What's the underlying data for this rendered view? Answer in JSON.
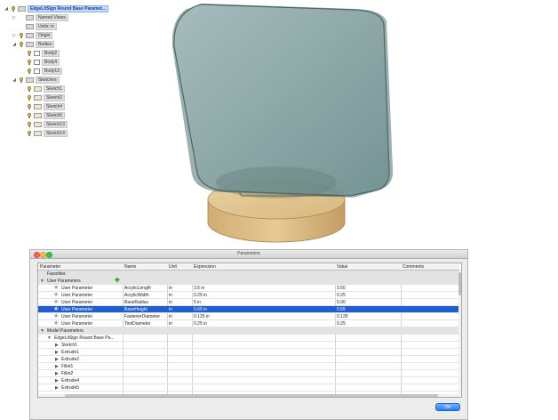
{
  "browser": {
    "nodes": [
      {
        "label": "EdgeLitSign Round Base Paramet...",
        "selected": true
      },
      {
        "label": "Named Views"
      },
      {
        "label": "Units: in"
      },
      {
        "label": "Origin"
      },
      {
        "label": "Bodies"
      },
      {
        "label": "Body2"
      },
      {
        "label": "Body4"
      },
      {
        "label": "Body13"
      },
      {
        "label": "Sketches"
      },
      {
        "label": "Sketch1"
      },
      {
        "label": "Sketch2"
      },
      {
        "label": "Sketch4"
      },
      {
        "label": "Sketch5"
      },
      {
        "label": "Sketch13"
      },
      {
        "label": "Sketch14"
      }
    ],
    "arrows": {
      "expanded": "◢",
      "collapsed": "▷"
    }
  },
  "viewport": {
    "colors": {
      "acrylic": "#7a9a9a",
      "acrylic_edge": "#4d6b6b",
      "wood_top": "#e2c48f",
      "wood_side": "#c9a56b",
      "wood_dark": "#a88450"
    }
  },
  "dialog": {
    "title": "Parameters",
    "ok_label": "OK",
    "window_buttons": {
      "close": "#fc605b",
      "minimize": "#fdbc40",
      "zoom": "#34c84a"
    },
    "columns": {
      "parameter": "Parameter",
      "name": "Name",
      "unit": "Unit",
      "expression": "Expression",
      "value": "Value",
      "comments": "Comments"
    },
    "favorites_label": "Favorites",
    "user_group_label": "User Parameters",
    "add_icon": "✚",
    "user_parameters": [
      {
        "parameter": "User Parameter",
        "name": "AcrylicLength",
        "unit": "in",
        "expression": "3.5 in",
        "value": "3.50",
        "comments": ""
      },
      {
        "parameter": "User Parameter",
        "name": "AcrylicWidth",
        "unit": "in",
        "expression": "0.25 in",
        "value": "0.25",
        "comments": ""
      },
      {
        "parameter": "User Parameter",
        "name": "BaseRadius",
        "unit": "in",
        "expression": "5 in",
        "value": "5.00",
        "comments": ""
      },
      {
        "parameter": "User Parameter",
        "name": "BaseHeight",
        "unit": "in",
        "expression": "0.65 in",
        "value": "0.65",
        "comments": "",
        "selected": true
      },
      {
        "parameter": "User Parameter",
        "name": "FastenerDiameter",
        "unit": "in",
        "expression": "0.125 in",
        "value": "0.125",
        "comments": ""
      },
      {
        "parameter": "User Parameter",
        "name": "ToolDiameter",
        "unit": "in",
        "expression": "0.25 in",
        "value": "0.25",
        "comments": ""
      }
    ],
    "model_group_label": "Model Parameters",
    "model_root": "EdgeLitSign Round Base Pa...",
    "model_features": [
      "Sketch1",
      "Extrude1",
      "Extrude2",
      "Fillet1",
      "Fillet2",
      "Extrude4",
      "Extrude5"
    ]
  }
}
